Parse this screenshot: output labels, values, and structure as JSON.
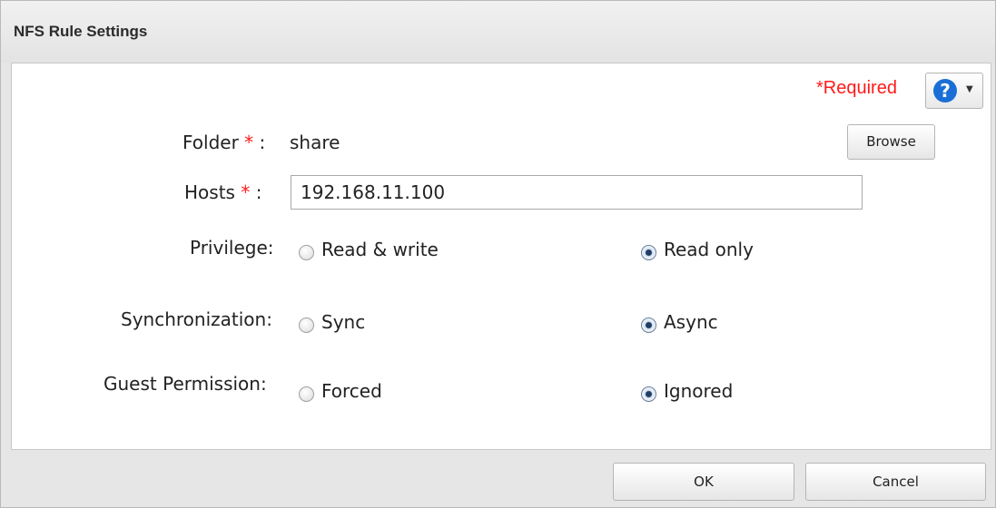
{
  "dialog": {
    "title": "NFS Rule Settings",
    "required_label": "*Required",
    "help_icon_glyph": "?",
    "help_caret_glyph": "▼"
  },
  "form": {
    "folder": {
      "label": "Folder",
      "star": "*",
      "separator": ":",
      "value": "share",
      "browse_label": "Browse"
    },
    "hosts": {
      "label": "Hosts",
      "star": "*",
      "separator": ":",
      "value": "192.168.11.100"
    },
    "privilege": {
      "label": "Privilege:",
      "options": [
        {
          "label": "Read & write",
          "checked": false
        },
        {
          "label": "Read only",
          "checked": true
        }
      ]
    },
    "synchronization": {
      "label": "Synchronization:",
      "options": [
        {
          "label": "Sync",
          "checked": false
        },
        {
          "label": "Async",
          "checked": true
        }
      ]
    },
    "guest_permission": {
      "label": "Guest Permission:",
      "options": [
        {
          "label": "Forced",
          "checked": false
        },
        {
          "label": "Ignored",
          "checked": true
        }
      ]
    }
  },
  "footer": {
    "ok_label": "OK",
    "cancel_label": "Cancel"
  },
  "colors": {
    "required": "#ff1a1a",
    "help_icon": "#1a6fd6",
    "panel_background": "#ffffff",
    "dialog_background": "#e6e6e6"
  }
}
